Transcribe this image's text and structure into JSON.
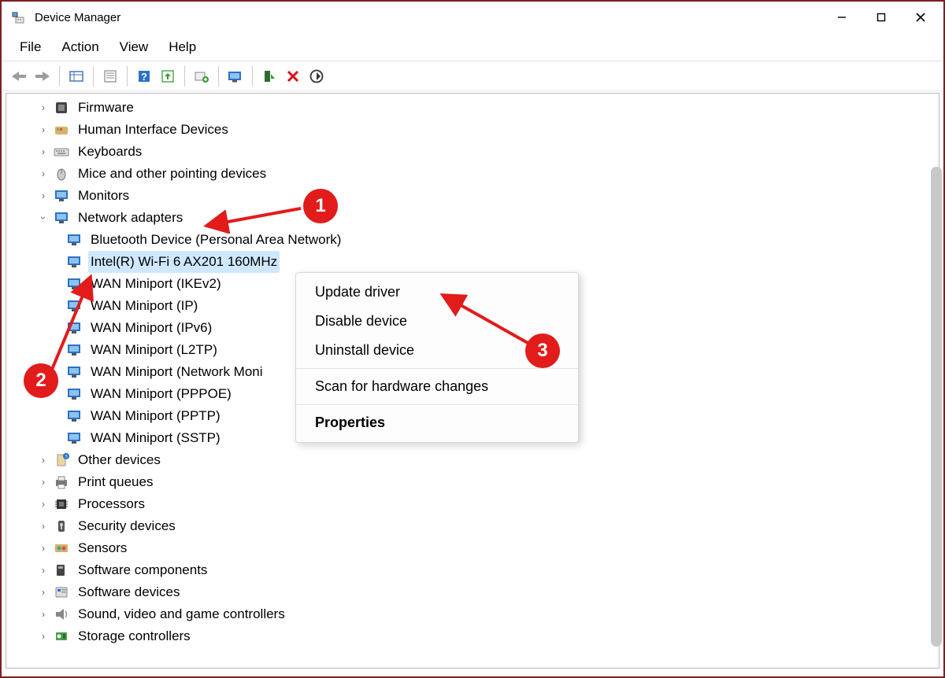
{
  "title": "Device Manager",
  "window_controls": {
    "minimize": "–",
    "maximize": "▢",
    "close": "✕"
  },
  "menu": [
    "File",
    "Action",
    "View",
    "Help"
  ],
  "toolbar_icons": [
    "back",
    "forward",
    "sep",
    "show-hidden",
    "sep",
    "properties",
    "sep",
    "help",
    "update",
    "sep",
    "uninstall",
    "sep",
    "scan",
    "sep",
    "enable",
    "disable",
    "rescan"
  ],
  "tree": {
    "collapsed": [
      {
        "label": "Firmware",
        "icon": "chip"
      },
      {
        "label": "Human Interface Devices",
        "icon": "hid"
      },
      {
        "label": "Keyboards",
        "icon": "keyboard"
      },
      {
        "label": "Mice and other pointing devices",
        "icon": "mouse"
      },
      {
        "label": "Monitors",
        "icon": "monitor"
      }
    ],
    "expanded": {
      "label": "Network adapters",
      "icon": "netcard",
      "children": [
        {
          "label": "Bluetooth Device (Personal Area Network)",
          "selected": false
        },
        {
          "label": "Intel(R) Wi-Fi 6 AX201 160MHz",
          "selected": true
        },
        {
          "label": "WAN Miniport (IKEv2)",
          "selected": false
        },
        {
          "label": "WAN Miniport (IP)",
          "selected": false
        },
        {
          "label": "WAN Miniport (IPv6)",
          "selected": false
        },
        {
          "label": "WAN Miniport (L2TP)",
          "selected": false
        },
        {
          "label": "WAN Miniport (Network Moni",
          "selected": false
        },
        {
          "label": "WAN Miniport (PPPOE)",
          "selected": false
        },
        {
          "label": "WAN Miniport (PPTP)",
          "selected": false
        },
        {
          "label": "WAN Miniport (SSTP)",
          "selected": false
        }
      ]
    },
    "collapsed_after": [
      {
        "label": "Other devices",
        "icon": "other"
      },
      {
        "label": "Print queues",
        "icon": "printer"
      },
      {
        "label": "Processors",
        "icon": "cpu"
      },
      {
        "label": "Security devices",
        "icon": "security"
      },
      {
        "label": "Sensors",
        "icon": "sensor"
      },
      {
        "label": "Software components",
        "icon": "swcomp"
      },
      {
        "label": "Software devices",
        "icon": "swdev"
      },
      {
        "label": "Sound, video and game controllers",
        "icon": "sound"
      },
      {
        "label": "Storage controllers",
        "icon": "storage"
      }
    ]
  },
  "context_menu": {
    "items": [
      {
        "label": "Update driver",
        "bold": false
      },
      {
        "label": "Disable device",
        "bold": false
      },
      {
        "label": "Uninstall device",
        "bold": false
      },
      {
        "sep": true
      },
      {
        "label": "Scan for hardware changes",
        "bold": false
      },
      {
        "sep": true
      },
      {
        "label": "Properties",
        "bold": true
      }
    ]
  },
  "annotations": {
    "1": "1",
    "2": "2",
    "3": "3"
  }
}
